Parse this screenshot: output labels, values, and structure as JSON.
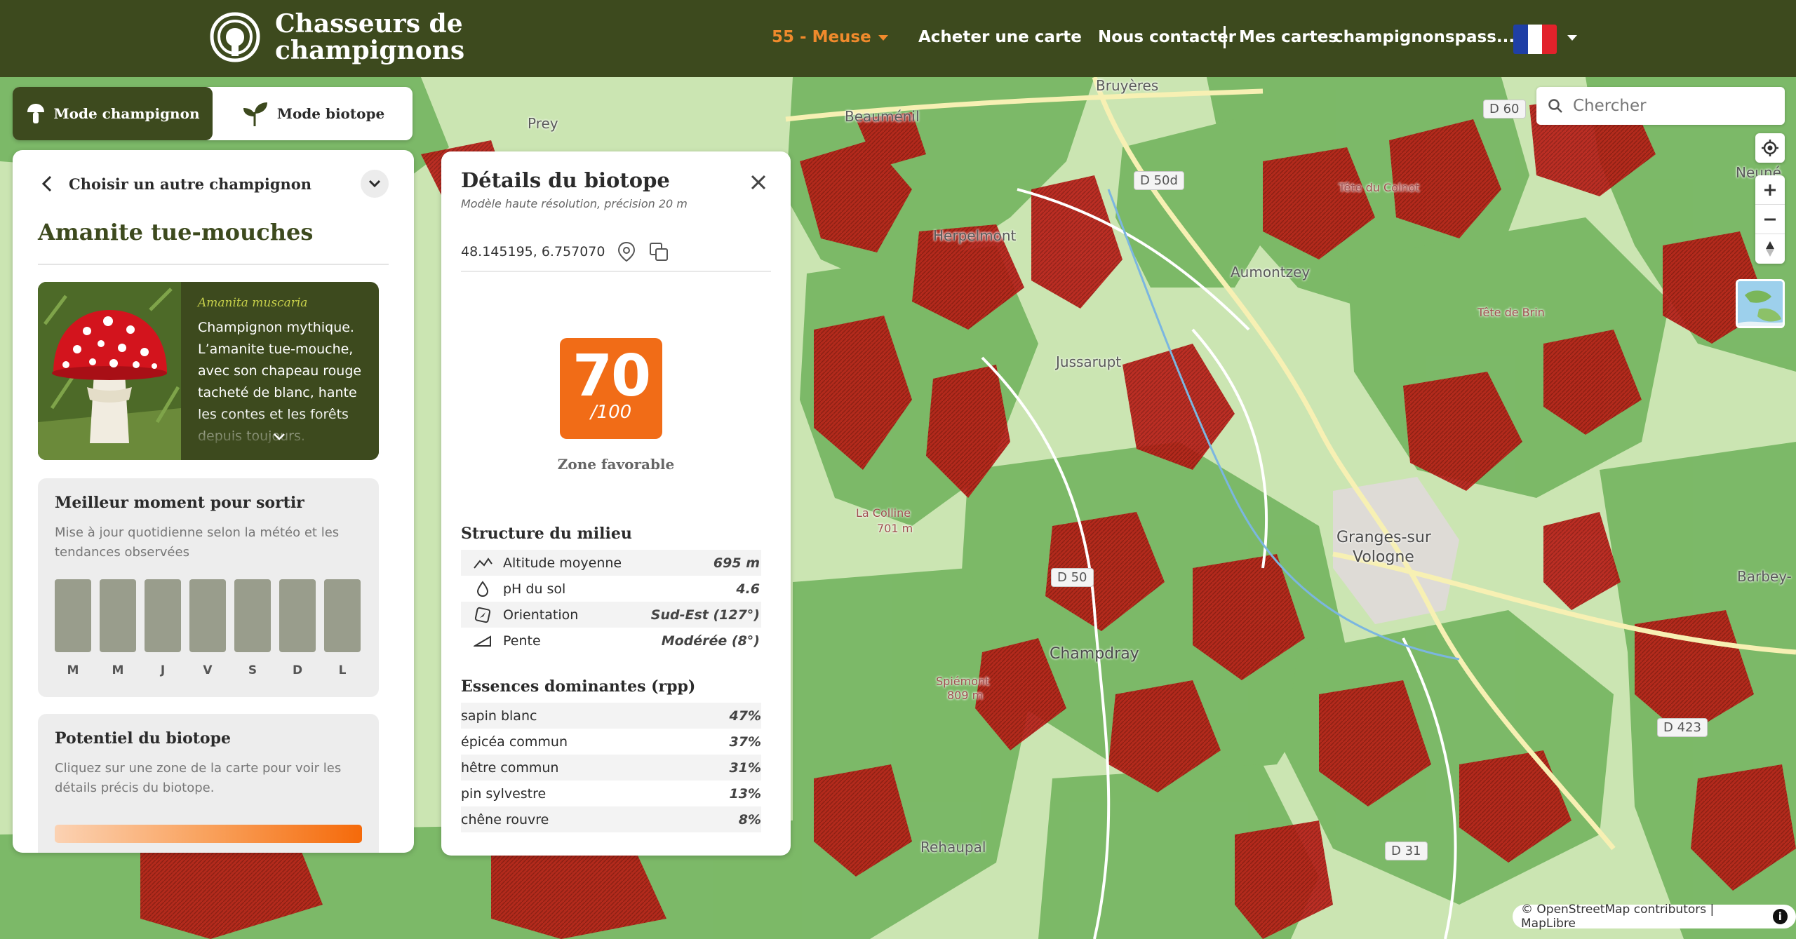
{
  "header": {
    "brand_line1": "Chasseurs de",
    "brand_line2": "champignons",
    "department": "55 - Meuse",
    "buy_map": "Acheter une carte",
    "contact": "Nous contacter",
    "my_maps": "Mes cartes",
    "account": "champignonspass...",
    "language_flag": "fr-flag"
  },
  "modes": {
    "mushroom": "Mode champignon",
    "biotope": "Mode biotope",
    "active": "mushroom"
  },
  "species_panel": {
    "choose_other": "Choisir un autre champignon",
    "common_name": "Amanite tue-mouches",
    "latin_name": "Amanita muscaria",
    "description": "Champignon mythique. L’amanite tue-mouche, avec son chapeau rouge tacheté de blanc, hante les contes et les forêts depuis toujours.",
    "best_time": {
      "title": "Meilleur moment pour sortir",
      "subtitle": "Mise à jour quotidienne selon la météo et les tendances observées",
      "days": [
        "M",
        "M",
        "J",
        "V",
        "S",
        "D",
        "L"
      ]
    },
    "potential": {
      "title": "Potentiel du biotope",
      "subtitle": "Cliquez sur une zone de la carte pour voir les détails précis du biotope."
    }
  },
  "biotope": {
    "title": "Détails du biotope",
    "subtitle": "Modèle haute résolution, précision 20 m",
    "coordinates": "48.145195, 6.757070",
    "score": "70",
    "score_max": "/100",
    "score_label": "Zone favorable",
    "structure_title": "Structure du milieu",
    "structure": [
      {
        "icon": "altitude-icon",
        "name": "Altitude moyenne",
        "value": "695 m"
      },
      {
        "icon": "ph-drop-icon",
        "name": "pH du sol",
        "value": "4.6"
      },
      {
        "icon": "compass-icon",
        "name": "Orientation",
        "value": "Sud-Est (127°)"
      },
      {
        "icon": "slope-icon",
        "name": "Pente",
        "value": "Modérée (8°)"
      }
    ],
    "species_title": "Essences dominantes (rpp)",
    "species": [
      {
        "name": "sapin blanc",
        "value": "47%"
      },
      {
        "name": "épicéa commun",
        "value": "37%"
      },
      {
        "name": "hêtre commun",
        "value": "31%"
      },
      {
        "name": "pin sylvestre",
        "value": "13%"
      },
      {
        "name": "chêne rouvre",
        "value": "8%"
      }
    ]
  },
  "map": {
    "search_placeholder": "Chercher",
    "attribution": "© OpenStreetMap contributors | MapLibre",
    "places": {
      "bruyeres": "Bruyères",
      "prey": "Prey",
      "beaumenil": "Beauménil",
      "herpelmont": "Herpelmont",
      "aumontzey": "Aumontzey",
      "jussarupt": "Jussarupt",
      "granges1": "Granges-sur",
      "granges2": "Vologne",
      "champdray": "Champdray",
      "rehaupal": "Rehaupal",
      "neune": "Neuné",
      "barbey": "Barbey-",
      "tete_colnot": "Tête du Colnot",
      "brin": "Tête de Brin",
      "spiemont": "Spiémont",
      "spiemont_alt": "809 m",
      "colline": "La Colline",
      "colline_alt": "701 m"
    },
    "roads": {
      "d60": "D 60",
      "d50d": "D 50d",
      "d50": "D 50",
      "d423": "D 423",
      "d31": "D 31"
    }
  }
}
